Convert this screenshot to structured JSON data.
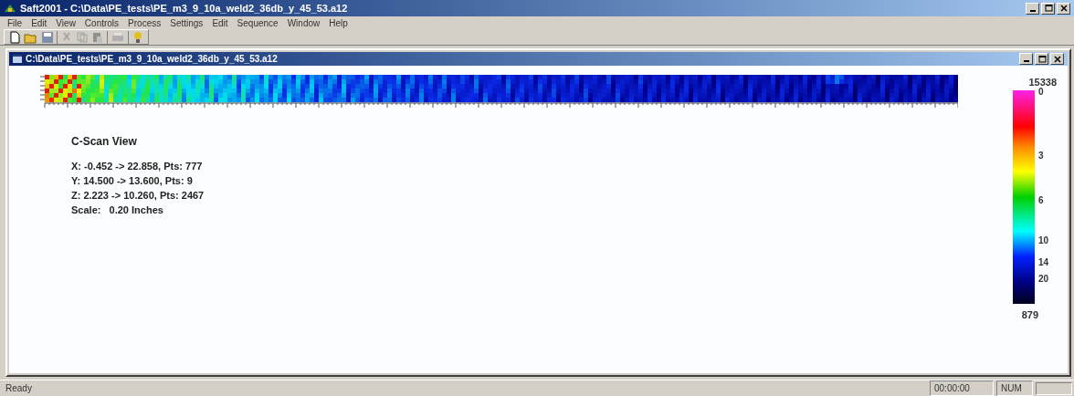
{
  "window": {
    "title": "Saft2001 - C:\\Data\\PE_tests\\PE_m3_9_10a_weld2_36db_y_45_53.a12"
  },
  "menu": [
    "File",
    "Edit",
    "View",
    "Controls",
    "Process",
    "Settings",
    "Edit",
    "Sequence",
    "Window",
    "Help"
  ],
  "child_window": {
    "title": "C:\\Data\\PE_tests\\PE_m3_9_10a_weld2_36db_y_45_53.a12"
  },
  "view": {
    "heading": "C-Scan View",
    "lines": [
      "X: -0.452 -> 22.858, Pts: 777",
      "Y: 14.500 -> 13.600, Pts: 9",
      "Z: 2.223 -> 10.260, Pts: 2467",
      "Scale:   0.20 Inches"
    ]
  },
  "color_bar": {
    "max": "15338",
    "min": "879",
    "ticks": [
      "0",
      "3",
      "6",
      "10",
      "14",
      "20"
    ]
  },
  "status_bar": [
    "Ready",
    "00:00:00",
    "NUM"
  ]
}
